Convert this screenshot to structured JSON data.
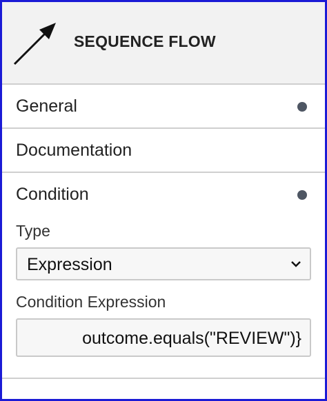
{
  "header": {
    "title": "SEQUENCE FLOW",
    "icon": "sequence-flow-arrow-icon"
  },
  "groups": [
    {
      "label": "General",
      "has_entries": true
    },
    {
      "label": "Documentation",
      "has_entries": false
    },
    {
      "label": "Condition",
      "has_entries": true
    }
  ],
  "condition": {
    "type_label": "Type",
    "type_value": "Expression",
    "expression_label": "Condition Expression",
    "expression_value": "outcome.equals(\"REVIEW\")}"
  },
  "colors": {
    "frame_border": "#1b1bd6",
    "header_bg": "#f2f2f2",
    "dot": "#4e5663"
  }
}
